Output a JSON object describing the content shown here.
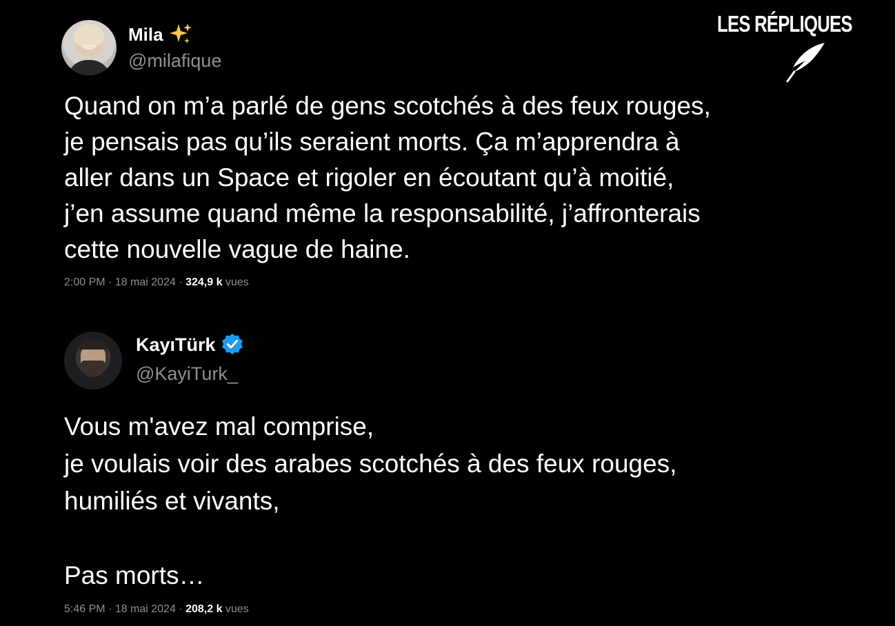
{
  "watermark": {
    "text": "LES RÉPLIQUES",
    "icon": "quill-icon"
  },
  "tweets": [
    {
      "author": {
        "name": "Mila",
        "name_icon": "sparkle-icon",
        "handle": "@milafique",
        "avatar": "avatar"
      },
      "text": "Quand on m’a parlé de gens scotchés à des feux rouges,\nje pensais pas qu’ils seraient morts. Ça m’apprendra à\naller dans un Space et rigoler en écoutant qu’à moitié,\nj’en assume quand même la responsabilité, j’affronterais\ncette nouvelle vague de haine.",
      "time": "2:00 PM",
      "date": "18 mai 2024",
      "views_count": "324,9 k",
      "views_label": "vues",
      "separator": " · "
    },
    {
      "author": {
        "name": "KayıTürk",
        "name_icon": "verified-icon",
        "handle": "@KayiTurk_",
        "avatar": "avatar",
        "badge_color": "#1d9bf0"
      },
      "text": "Vous m'avez mal comprise,\nje voulais voir des arabes scotchés à des feux rouges,\nhumiliés et vivants,\n\nPas morts…",
      "time": "5:46 PM",
      "date": "18 mai 2024",
      "views_count": "208,2 k",
      "views_label": "vues",
      "separator": " · "
    }
  ],
  "colors": {
    "background": "#000000",
    "text": "#ffffff",
    "secondary": "#8b9095",
    "sparkle": "#f7c84a",
    "verified": "#1d9bf0"
  }
}
